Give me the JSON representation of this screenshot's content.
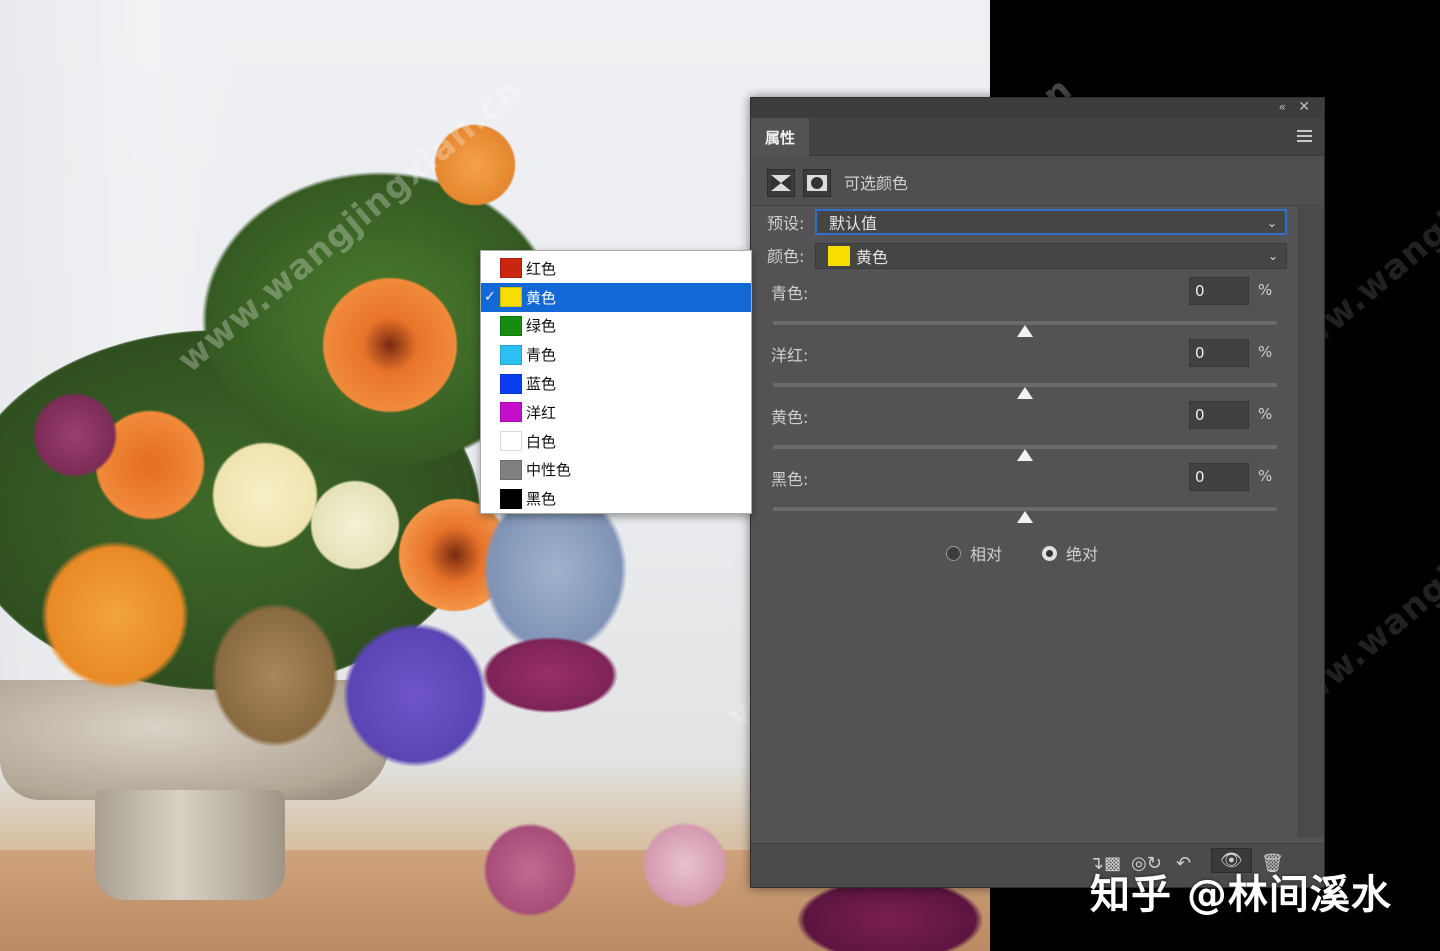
{
  "panel": {
    "tab_label": "属性",
    "adjustment_title": "可选颜色",
    "preset_label": "预设:",
    "preset_value": "默认值",
    "color_label": "颜色:",
    "color_value": "黄色",
    "sliders": [
      {
        "label": "青色:",
        "value": "0",
        "unit": "%"
      },
      {
        "label": "洋红:",
        "value": "0",
        "unit": "%"
      },
      {
        "label": "黄色:",
        "value": "0",
        "unit": "%"
      },
      {
        "label": "黑色:",
        "value": "0",
        "unit": "%"
      }
    ],
    "mode_options": [
      {
        "label": "相对",
        "selected": false
      },
      {
        "label": "绝对",
        "selected": true
      }
    ]
  },
  "color_menu": {
    "selected_index": 1,
    "items": [
      {
        "label": "红色",
        "color": "#c8260e"
      },
      {
        "label": "黄色",
        "color": "#f7dd02"
      },
      {
        "label": "绿色",
        "color": "#178a10"
      },
      {
        "label": "青色",
        "color": "#2bc0f1"
      },
      {
        "label": "蓝色",
        "color": "#0a3ef0"
      },
      {
        "label": "洋红",
        "color": "#c40fc9"
      },
      {
        "label": "白色",
        "color": "#ffffff"
      },
      {
        "label": "中性色",
        "color": "#808080"
      },
      {
        "label": "黑色",
        "color": "#000000"
      }
    ]
  },
  "watermark": "www.wangjingxian.cn",
  "credit": "知乎 @林间溪水"
}
